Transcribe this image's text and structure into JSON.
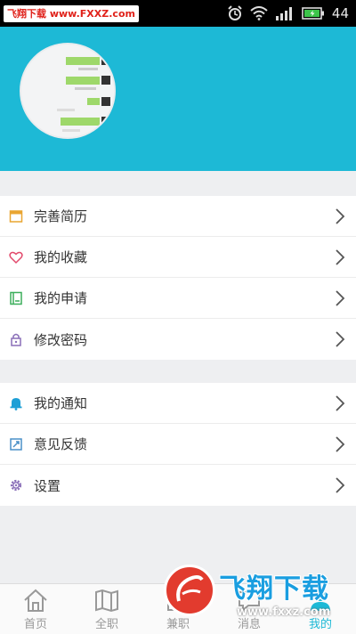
{
  "status_bar": {
    "watermark": "飞翔下载 www.FXXZ.com",
    "battery_level": "44",
    "icons": [
      "alarm-icon",
      "wifi-icon",
      "signal-icon",
      "battery-icon"
    ]
  },
  "profile": {
    "avatar": "avatar-chat-screenshot"
  },
  "menu_group_1": [
    {
      "label": "完善简历",
      "icon": "resume-icon"
    },
    {
      "label": "我的收藏",
      "icon": "heart-icon"
    },
    {
      "label": "我的申请",
      "icon": "application-icon"
    },
    {
      "label": "修改密码",
      "icon": "lock-icon"
    }
  ],
  "menu_group_2": [
    {
      "label": "我的通知",
      "icon": "bell-icon"
    },
    {
      "label": "意见反馈",
      "icon": "feedback-icon"
    },
    {
      "label": "设置",
      "icon": "gear-icon"
    }
  ],
  "bottom_nav": [
    {
      "label": "首页",
      "icon": "home-icon",
      "active": false
    },
    {
      "label": "全职",
      "icon": "map-icon",
      "active": false
    },
    {
      "label": "兼职",
      "icon": "parttime-icon",
      "active": false
    },
    {
      "label": "消息",
      "icon": "message-icon",
      "active": false
    },
    {
      "label": "我的",
      "icon": "user-icon",
      "active": true
    }
  ],
  "corner_watermark": {
    "text_cn": "飞翔下载",
    "url": "www.fxxz.com"
  },
  "colors": {
    "accent": "#1db9d6",
    "background": "#eeeff1"
  }
}
